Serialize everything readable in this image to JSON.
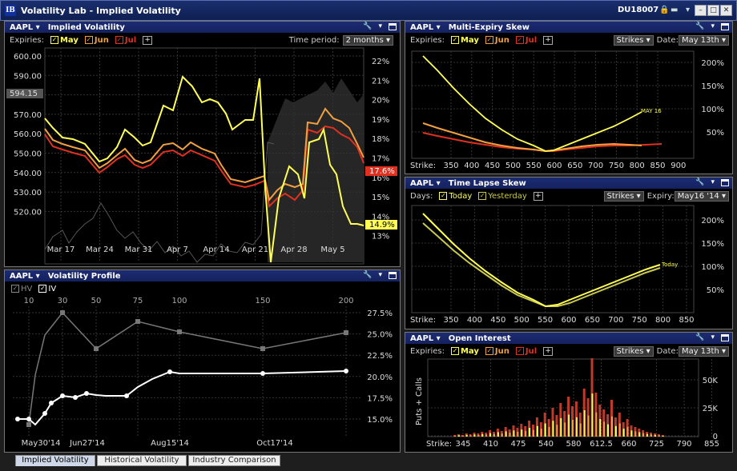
{
  "app": {
    "logo": "IB",
    "title": "Volatility Lab - Implied Volatility",
    "account": "DU18007"
  },
  "p1": {
    "symbol": "AAPL",
    "title": "Implied Volatility",
    "expiries_label": "Expiries:",
    "series": [
      {
        "name": "May",
        "color": "#ffff55"
      },
      {
        "name": "Jun",
        "color": "#f0a040"
      },
      {
        "name": "Jul",
        "color": "#e03020"
      }
    ],
    "period_label": "Time period:",
    "period_value": "2 months",
    "left_ticks": [
      "600.00",
      "590.00",
      "580.00",
      "570.00",
      "560.00",
      "550.00",
      "540.00",
      "530.00",
      "520.00"
    ],
    "right_ticks": [
      "22%",
      "21%",
      "20%",
      "19%",
      "18%",
      "17%",
      "16%",
      "15%",
      "14%",
      "13%"
    ],
    "x_ticks": [
      "Mar 17",
      "Mar 24",
      "Mar 31",
      "Apr 7",
      "Apr 14",
      "Apr 21",
      "Apr 28",
      "May 5"
    ],
    "price_flag": "594.15",
    "red_flag": "17.6%",
    "yellow_flag": "14.9%"
  },
  "p2": {
    "symbol": "AAPL",
    "title": "Volatility Profile",
    "hv_label": "HV",
    "iv_label": "IV",
    "top_ticks": [
      "10",
      "30",
      "50",
      "75",
      "100",
      "150",
      "200"
    ],
    "y_ticks": [
      "27.5%",
      "25.0%",
      "22.5%",
      "20.0%",
      "17.5%",
      "15.0%"
    ],
    "x_ticks": [
      "May30'14",
      "Jun27'14",
      "Aug15'14",
      "Oct17'14"
    ]
  },
  "p3": {
    "symbol": "AAPL",
    "title": "Multi-Expiry Skew",
    "expiries_label": "Expiries:",
    "series": [
      "May",
      "Jun",
      "Jul"
    ],
    "strikes_label": "Strikes",
    "date_label": "Date:",
    "date_value": "May 13th",
    "y_ticks": [
      "200%",
      "150%",
      "100%",
      "50%"
    ],
    "strike_label": "Strike:",
    "x_ticks": [
      "350",
      "400",
      "450",
      "500",
      "550",
      "600",
      "650",
      "700",
      "750",
      "800",
      "850",
      "900"
    ],
    "curve_label": "MAY 16"
  },
  "p4": {
    "symbol": "AAPL",
    "title": "Time Lapse Skew",
    "days_label": "Days:",
    "today_label": "Today",
    "yesterday_label": "Yesterday",
    "strikes_label": "Strikes",
    "expiry_label": "Expiry:",
    "expiry_value": "May16 '14",
    "y_ticks": [
      "200%",
      "150%",
      "100%",
      "50%"
    ],
    "strike_label": "Strike:",
    "x_ticks": [
      "350",
      "400",
      "450",
      "500",
      "550",
      "600",
      "650",
      "700",
      "750",
      "800",
      "850"
    ],
    "curve_label": "Today"
  },
  "p5": {
    "symbol": "AAPL",
    "title": "Open Interest",
    "expiries_label": "Expiries:",
    "series": [
      "May",
      "Jun",
      "Jul"
    ],
    "strikes_label": "Strikes",
    "date_label": "Date:",
    "date_value": "May 13th",
    "y_axis_label": "Puts + Calls",
    "y_ticks": [
      "50K",
      "25K",
      "0"
    ],
    "strike_label": "Strike:",
    "x_ticks": [
      "345",
      "410",
      "475",
      "540",
      "580",
      "612.5",
      "660",
      "725",
      "790",
      "855"
    ]
  },
  "tabs": [
    "Implied Volatility",
    "Historical Volatility",
    "Industry Comparison"
  ]
}
